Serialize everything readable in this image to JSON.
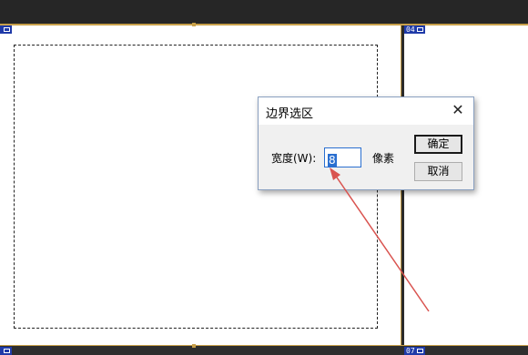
{
  "frame_tags": {
    "top_left": "",
    "top_right": "04",
    "bottom_left": "",
    "bottom_right": "07"
  },
  "dialog": {
    "title": "边界选区",
    "close_glyph": "✕",
    "width_label": "宽度(W):",
    "width_value": "8",
    "unit": "像素",
    "ok_label": "确定",
    "cancel_label": "取消"
  },
  "icons": {
    "tag": "frame-tag-icon",
    "close": "close-icon",
    "annotation": "red-arrow"
  },
  "colors": {
    "accent": "#2a6fd0",
    "annotation": "#d9534f",
    "tag_bg": "#1f3aa8"
  }
}
